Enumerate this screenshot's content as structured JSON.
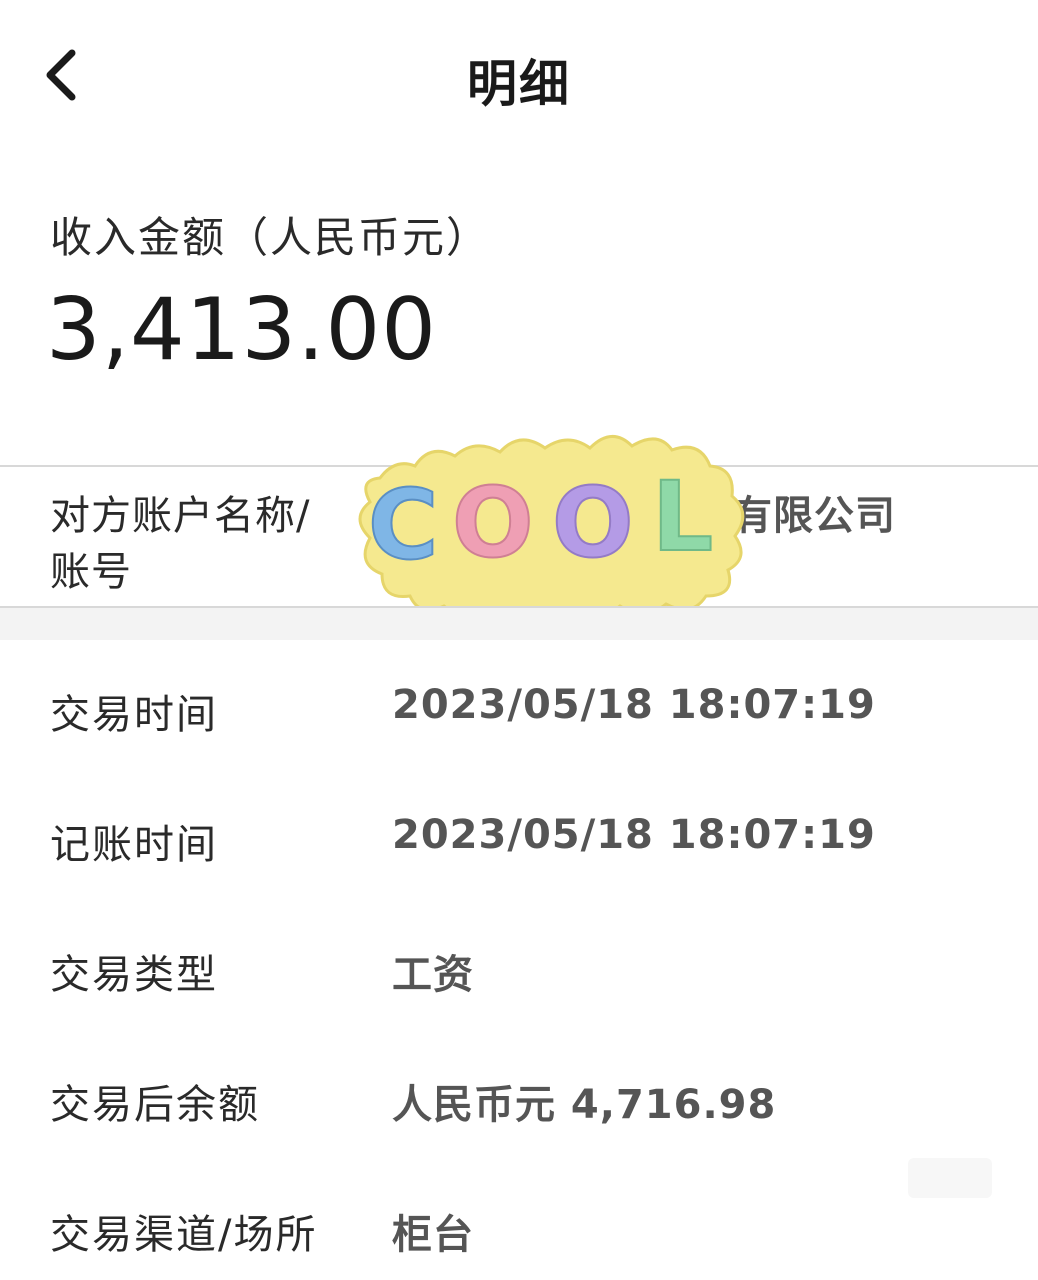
{
  "header": {
    "title": "明细",
    "back_icon": "chevron-left-icon"
  },
  "income": {
    "label": "收入金额（人民币元）",
    "amount": "3,413.00"
  },
  "counterparty": {
    "label_line1": "对方账户名称/",
    "label_line2": "账号",
    "value": "有限公司",
    "sticker_text": "COOL"
  },
  "details": [
    {
      "label": "交易时间",
      "value": "2023/05/18  18:07:19"
    },
    {
      "label": "记账时间",
      "value": "2023/05/18  18:07:19"
    },
    {
      "label": "交易类型",
      "value": "工资"
    },
    {
      "label": "交易后余额",
      "value": "人民币元 4,716.98"
    },
    {
      "label": "交易渠道/场所",
      "value": "柜台"
    }
  ],
  "colors": {
    "text_primary": "#1a1a1a",
    "text_value": "#555555",
    "divider": "#d8d8d8",
    "sticker_bg": "#f5e98f",
    "sticker_c": "#7fb6e6",
    "sticker_o1": "#ef9fb4",
    "sticker_o2": "#b49be6",
    "sticker_l": "#8fd9a8"
  }
}
